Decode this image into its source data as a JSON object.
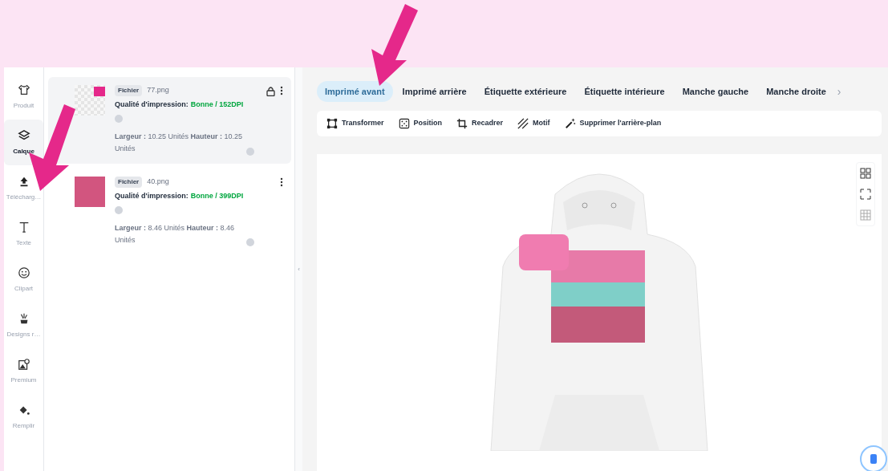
{
  "sidebar": {
    "items": [
      {
        "label": "Produit",
        "selected": false
      },
      {
        "label": "Calque",
        "selected": true
      },
      {
        "label": "Télécharg…",
        "selected": false
      },
      {
        "label": "Texte",
        "selected": false
      },
      {
        "label": "Clipart",
        "selected": false
      },
      {
        "label": "Designs r…",
        "selected": false
      },
      {
        "label": "Premium",
        "selected": false
      },
      {
        "label": "Remplir",
        "selected": false
      }
    ]
  },
  "layers": [
    {
      "kind": "design",
      "badge": "Fichier",
      "filename": "77.png",
      "quality_label": "Qualité d'impression:",
      "quality_value": "Bonne / 152DPI",
      "size": "**Largeur :** 10.25 Unités **Hauteur :** 10.25 Unités",
      "locked": true,
      "selected": true
    },
    {
      "kind": "photo",
      "badge": "Fichier",
      "filename": "40.png",
      "quality_label": "Qualité d'impression:",
      "quality_value": "Bonne / 399DPI",
      "size": "**Largeur :** 8.46 Unités **Hauteur :** 8.46 Unités",
      "locked": false,
      "selected": false
    }
  ],
  "placement_tabs": [
    {
      "label": "Imprimé avant",
      "selected": true
    },
    {
      "label": "Imprimé arrière",
      "selected": false
    },
    {
      "label": "Étiquette extérieure",
      "selected": false
    },
    {
      "label": "Étiquette intérieure",
      "selected": false
    },
    {
      "label": "Manche gauche",
      "selected": false
    },
    {
      "label": "Manche droite",
      "selected": false
    }
  ],
  "tabs_next": "›",
  "collapse_handle": "‹",
  "toolbar": [
    {
      "label": "Transformer"
    },
    {
      "label": "Position"
    },
    {
      "label": "Recadrer"
    },
    {
      "label": "Motif"
    },
    {
      "label": "Supprimer l'arrière-plan"
    }
  ]
}
